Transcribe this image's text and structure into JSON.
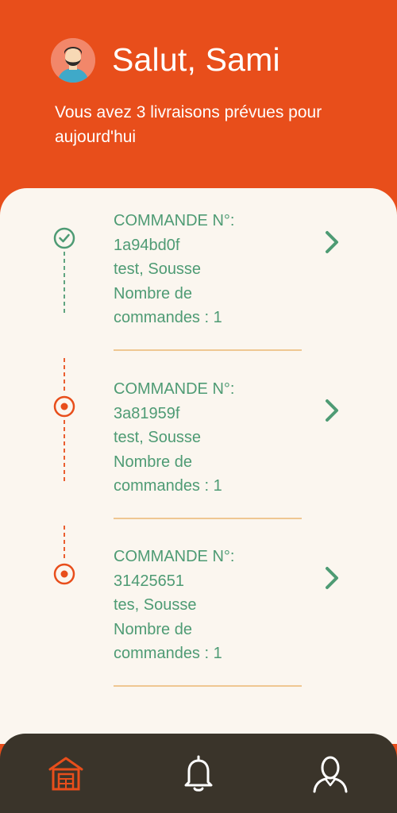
{
  "header": {
    "greeting": "Salut, Sami",
    "subtitle": "Vous avez 3 livraisons prévues pour aujourd'hui"
  },
  "orders": [
    {
      "title": "COMMANDE N°:",
      "number": "1a94bd0f",
      "location": "test, Sousse",
      "count_label_1": "Nombre de",
      "count_label_2": "commandes : 1",
      "status": "delivered",
      "status_icon": "check-circle-icon"
    },
    {
      "title": "COMMANDE N°:",
      "number": "3a81959f",
      "location": "test, Sousse",
      "count_label_1": "Nombre de",
      "count_label_2": "commandes : 1",
      "status": "pending",
      "status_icon": "target-circle-icon"
    },
    {
      "title": "COMMANDE N°:",
      "number": "31425651",
      "location": "tes, Sousse",
      "count_label_1": "Nombre de",
      "count_label_2": "commandes : 1",
      "status": "pending",
      "status_icon": "target-circle-icon"
    }
  ],
  "nav": {
    "items": [
      {
        "icon": "home-icon",
        "active": true
      },
      {
        "icon": "bell-icon",
        "active": false
      },
      {
        "icon": "user-icon",
        "active": false
      }
    ]
  },
  "colors": {
    "brand": "#E84E1B",
    "green": "#4E9B74",
    "panel": "#FBF6EF",
    "divider": "#EFC792",
    "nav_bg": "#3A342A"
  }
}
